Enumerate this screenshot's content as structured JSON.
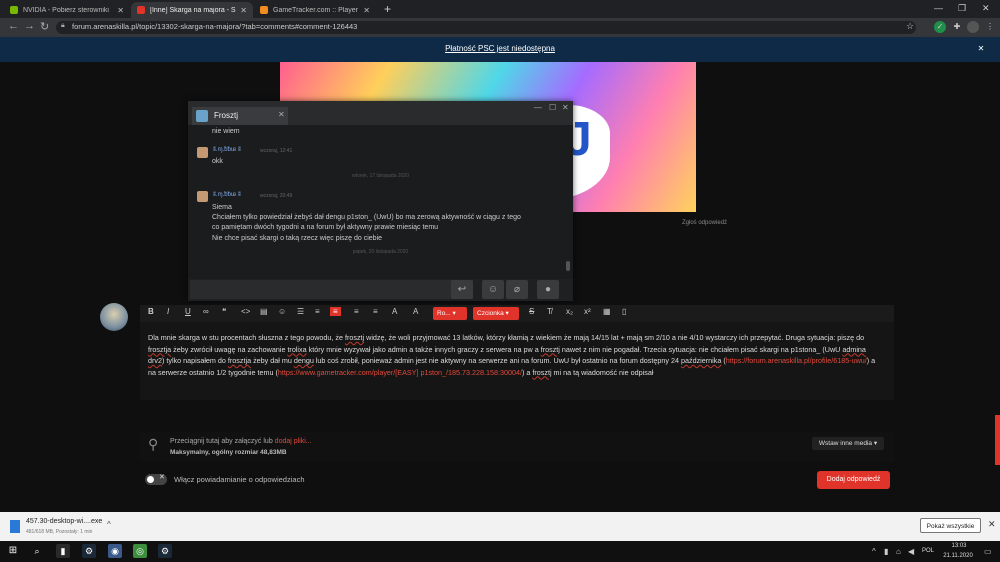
{
  "browser": {
    "tabs": [
      {
        "title": "NVIDIA - Pobierz sterowniki",
        "favicon_color": "#76b900",
        "active": false
      },
      {
        "title": "[Inne] Skarga na majora - Skarg",
        "favicon_color": "#e0342b",
        "active": true
      },
      {
        "title": "GameTracker.com :: Player Page F",
        "favicon_color": "#f28c1e",
        "active": false
      }
    ],
    "new_tab": "+",
    "url": "forum.arenaskilla.pl/topic/13302-skarga-na-majora/?tab=comments#comment-126443"
  },
  "notice": {
    "text": "Płatność PSC jest niedostępna",
    "close": "✕"
  },
  "post": {
    "report_link": "Zgłoś odpowiedź"
  },
  "chat": {
    "tab_name": "Frosztj",
    "messages": [
      {
        "text": "nie wiem"
      },
      {
        "name": "ʬ.ɱ.ᵬᵬᵫ ʬ",
        "time": "wczoraj, 12:41",
        "text": "okk"
      },
      {
        "date_sep": "wtorek, 17 listopada 2020"
      },
      {
        "name": "ʬ.ɱ.ᵬᵬᵫ ʬ",
        "time": "wczoraj, 20:49",
        "lines": [
          "Siema",
          "Chciałem tylko powiedział żebyś dał dengu p1ston_ (UwU) bo ma zerową aktywność w ciągu z tego",
          "co pamiętam dwóch tygodni a na forum był aktywny prawie miesiąc temu",
          "Nie chce pisać skargi o taką rzecz więc piszę do ciebie"
        ]
      },
      {
        "date_sep": "piątek, 20 listopada 2020"
      }
    ]
  },
  "editor": {
    "toolbar": {
      "font_select": "Ro...",
      "color_select": "Czcionka"
    },
    "lines": [
      [
        {
          "t": "Dla mnie skarga w stu procentach słuszna z tego powodu, że "
        },
        {
          "t": "frosztj",
          "u": true
        },
        {
          "t": " widzę, że woli przyjmować 13 latków, którzy kłamią z wiekiem że mają 14/15 lat + mają sm 2/10 a nie 4/10 wystarczy ich przepytać. Druga sytuacja: piszę do"
        }
      ],
      [
        {
          "t": "frosztja",
          "u": true
        },
        {
          "t": " żeby zwrócił uwagę na zachowanie "
        },
        {
          "t": "trolixa",
          "u": true
        },
        {
          "t": " który mnie wyzywał jako admin a także innych graczy z serwera na pw a "
        },
        {
          "t": "frosztj",
          "u": true
        },
        {
          "t": " nawet z nim nie pogadał. Trzecia sytuacja: nie chciałem pisać skargi na p1stona_ (UwU "
        },
        {
          "t": "admina",
          "u": true
        }
      ],
      [
        {
          "t": "drv2",
          "u": true
        },
        {
          "t": ") tylko napisałem do "
        },
        {
          "t": "frosztja",
          "u": true
        },
        {
          "t": " żeby dał mu "
        },
        {
          "t": "dengu",
          "u": true
        },
        {
          "t": " lub coś zrobił, ponieważ admin jest nie aktywny na serwerze ani na forum. UwU był ostatnio na forum dostępny 24 "
        },
        {
          "t": "października",
          "u": true
        },
        {
          "t": " ("
        },
        {
          "t": "https://forum.arenaskilla.pl/profile/6185-uwu/",
          "link": true
        },
        {
          "t": ") a"
        }
      ],
      [
        {
          "t": "na serwerze ostatnio 1/2 tygodnie temu ("
        },
        {
          "t": "https://www.gametracker.com/player/[EASY] p1ston_/185.73.228.158:30004/",
          "link": true
        },
        {
          "t": ") a "
        },
        {
          "t": "frosztj",
          "u": true
        },
        {
          "t": " mi na tą wiadomość nie odpisał"
        }
      ]
    ]
  },
  "attachments": {
    "drop_text": "Przeciągnij tutaj aby załączyć lub ",
    "drop_link": "dodaj pliki...",
    "max_text": "Maksymalny, ogólny rozmiar 48,83MB",
    "media_button": "Wstaw inne media ▾"
  },
  "notify": {
    "label": "Włącz powiadamianie o odpowiedziach",
    "enabled": false
  },
  "submit_label": "Dodaj odpowiedź",
  "download": {
    "filename": "457.30-desktop-wi....exe",
    "status": "481/618 MB, Pozostały: 1 min",
    "show_all": "Pokaż wszystkie"
  },
  "taskbar": {
    "lang": "POL",
    "time": "13:03",
    "date": "21.11.2020"
  },
  "colors": {
    "accent": "#e0342b",
    "notice_bg": "#0e2a47",
    "link": "#e24a3c"
  }
}
